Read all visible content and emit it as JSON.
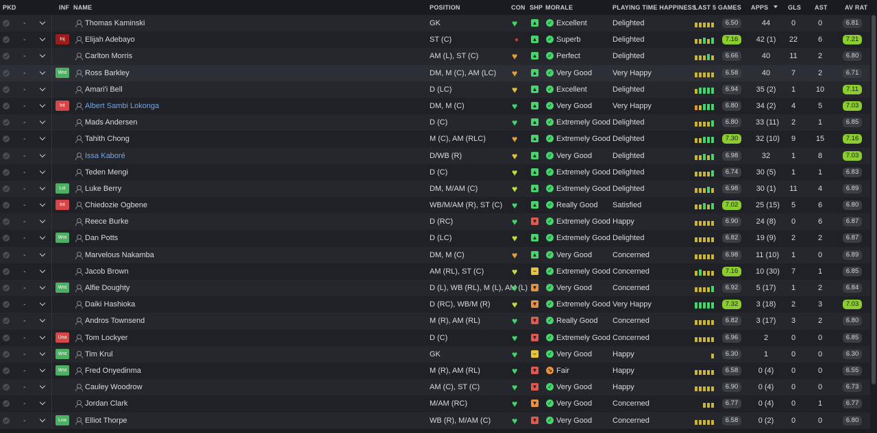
{
  "headers": {
    "pkd": "PKD",
    "inf": "INF",
    "name": "NAME",
    "position": "POSITION",
    "con": "CON",
    "shp": "SHP",
    "morale": "MORALE",
    "pth": "PLAYING TIME HAPPINESS",
    "last5": "LAST 5 GAMES",
    "apps": "APPS",
    "gls": "GLS",
    "ast": "AST",
    "avrat": "AV RAT"
  },
  "colors": {
    "green": "#44d66a",
    "yellow": "#e7c33a",
    "orange": "#e8913d",
    "red": "#e2584e",
    "rating_good": "#8bcd2e",
    "link": "#6fa8e8"
  },
  "players": [
    {
      "name": "Thomas Kaminski",
      "inf": "",
      "pos": "GK",
      "con": "g",
      "shp": "g",
      "mor": "g",
      "morale": "Excellent",
      "pth": "Delighted",
      "l5": "6.50",
      "l5hi": false,
      "bars": [
        "y",
        "y",
        "y",
        "y",
        "y"
      ],
      "apps": "44",
      "gls": "0",
      "ast": "0",
      "av": "6.81",
      "avhi": false,
      "link": false,
      "hl": false
    },
    {
      "name": "Elijah Adebayo",
      "inf": "Inj",
      "infc": "dred",
      "pos": "ST (C)",
      "con": "injdot",
      "shp": "g",
      "mor": "g",
      "morale": "Superb",
      "pth": "Delighted",
      "l5": "7.16",
      "l5hi": true,
      "bars": [
        "y",
        "y",
        "g",
        "y",
        "g"
      ],
      "apps": "42 (1)",
      "gls": "22",
      "ast": "6",
      "av": "7.21",
      "avhi": true,
      "link": false,
      "hl": false
    },
    {
      "name": "Carlton Morris",
      "inf": "",
      "pos": "AM (L), ST (C)",
      "con": "o",
      "shp": "g",
      "mor": "g",
      "morale": "Perfect",
      "pth": "Delighted",
      "l5": "6.66",
      "l5hi": false,
      "bars": [
        "y",
        "y",
        "y",
        "g",
        "y"
      ],
      "apps": "40",
      "gls": "11",
      "ast": "2",
      "av": "6.80",
      "avhi": false,
      "link": false,
      "hl": false
    },
    {
      "name": "Ross Barkley",
      "inf": "Wnt",
      "infc": "green",
      "pos": "DM, M (C), AM (LC)",
      "con": "o",
      "shp": "g",
      "mor": "g",
      "morale": "Very Good",
      "pth": "Very Happy",
      "l5": "6.58",
      "l5hi": false,
      "bars": [
        "y",
        "y",
        "y",
        "y",
        "y"
      ],
      "apps": "40",
      "gls": "7",
      "ast": "2",
      "av": "6.71",
      "avhi": false,
      "link": false,
      "hl": true
    },
    {
      "name": "Amari'i Bell",
      "inf": "",
      "pos": "D (LC)",
      "con": "y",
      "shp": "g",
      "mor": "g",
      "morale": "Excellent",
      "pth": "Delighted",
      "l5": "6.94",
      "l5hi": false,
      "bars": [
        "y",
        "g",
        "g",
        "g",
        "g"
      ],
      "apps": "35 (2)",
      "gls": "1",
      "ast": "10",
      "av": "7.11",
      "avhi": true,
      "link": false,
      "hl": false
    },
    {
      "name": "Albert Sambi Lokonga",
      "inf": "Int",
      "infc": "red",
      "pos": "DM, M (C)",
      "con": "g",
      "shp": "g",
      "mor": "g",
      "morale": "Very Good",
      "pth": "Very Happy",
      "l5": "6.80",
      "l5hi": false,
      "bars": [
        "o",
        "y",
        "g",
        "g",
        "g"
      ],
      "apps": "34 (2)",
      "gls": "4",
      "ast": "5",
      "av": "7.03",
      "avhi": true,
      "link": true,
      "hl": false
    },
    {
      "name": "Mads Andersen",
      "inf": "",
      "pos": "D (C)",
      "con": "g",
      "shp": "g",
      "mor": "g",
      "morale": "Extremely Good",
      "pth": "Delighted",
      "l5": "6.80",
      "l5hi": false,
      "bars": [
        "y",
        "y",
        "y",
        "y",
        "g"
      ],
      "apps": "33 (11)",
      "gls": "2",
      "ast": "1",
      "av": "6.85",
      "avhi": false,
      "link": false,
      "hl": false
    },
    {
      "name": "Tahith Chong",
      "inf": "",
      "pos": "M (C), AM (RLC)",
      "con": "o",
      "shp": "g",
      "mor": "g",
      "morale": "Extremely Good",
      "pth": "Delighted",
      "l5": "7.30",
      "l5hi": true,
      "bars": [
        "y",
        "y",
        "g",
        "g",
        "g"
      ],
      "apps": "32 (10)",
      "gls": "9",
      "ast": "15",
      "av": "7.16",
      "avhi": true,
      "link": false,
      "hl": false
    },
    {
      "name": "Issa Kaboré",
      "inf": "",
      "pos": "D/WB (R)",
      "con": "y",
      "shp": "g",
      "mor": "g",
      "morale": "Very Good",
      "pth": "Delighted",
      "l5": "6.98",
      "l5hi": false,
      "bars": [
        "y",
        "y",
        "g",
        "y",
        "g"
      ],
      "apps": "32",
      "gls": "1",
      "ast": "8",
      "av": "7.03",
      "avhi": true,
      "link": true,
      "hl": false
    },
    {
      "name": "Teden Mengi",
      "inf": "",
      "pos": "D (C)",
      "con": "lime",
      "shp": "g",
      "mor": "g",
      "morale": "Extremely Good",
      "pth": "Delighted",
      "l5": "6.74",
      "l5hi": false,
      "bars": [
        "y",
        "y",
        "y",
        "y",
        "g"
      ],
      "apps": "30 (5)",
      "gls": "1",
      "ast": "1",
      "av": "6.83",
      "avhi": false,
      "link": false,
      "hl": false
    },
    {
      "name": "Luke Berry",
      "inf": "Lst",
      "infc": "green",
      "pos": "DM, M/AM (C)",
      "con": "lime",
      "shp": "g",
      "mor": "g",
      "morale": "Extremely Good",
      "pth": "Delighted",
      "l5": "6.98",
      "l5hi": false,
      "bars": [
        "y",
        "y",
        "y",
        "g",
        "y"
      ],
      "apps": "30 (1)",
      "gls": "11",
      "ast": "4",
      "av": "6.89",
      "avhi": false,
      "link": false,
      "hl": false
    },
    {
      "name": "Chiedozie Ogbene",
      "inf": "Int",
      "infc": "red",
      "pos": "WB/M/AM (R), ST (C)",
      "con": "g",
      "shp": "g",
      "mor": "g",
      "morale": "Really Good",
      "pth": "Satisfied",
      "l5": "7.02",
      "l5hi": true,
      "bars": [
        "y",
        "y",
        "g",
        "y",
        "g"
      ],
      "apps": "25 (15)",
      "gls": "5",
      "ast": "6",
      "av": "6.80",
      "avhi": false,
      "link": false,
      "hl": false
    },
    {
      "name": "Reece Burke",
      "inf": "",
      "pos": "D (RC)",
      "con": "g",
      "shp": "r",
      "mor": "g",
      "morale": "Extremely Good",
      "pth": "Happy",
      "l5": "6.90",
      "l5hi": false,
      "bars": [
        "y",
        "y",
        "y",
        "y",
        "y"
      ],
      "apps": "24 (8)",
      "gls": "0",
      "ast": "6",
      "av": "6.87",
      "avhi": false,
      "link": false,
      "hl": false
    },
    {
      "name": "Dan Potts",
      "inf": "Wnt",
      "infc": "green",
      "pos": "D (LC)",
      "con": "lime",
      "shp": "g",
      "mor": "g",
      "morale": "Extremely Good",
      "pth": "Delighted",
      "l5": "6.82",
      "l5hi": false,
      "bars": [
        "y",
        "y",
        "y",
        "y",
        "y"
      ],
      "apps": "19 (9)",
      "gls": "2",
      "ast": "2",
      "av": "6.87",
      "avhi": false,
      "link": false,
      "hl": false
    },
    {
      "name": "Marvelous Nakamba",
      "inf": "",
      "pos": "DM, M (C)",
      "con": "o",
      "shp": "g",
      "mor": "g",
      "morale": "Very Good",
      "pth": "Concerned",
      "l5": "6.98",
      "l5hi": false,
      "bars": [
        "y",
        "y",
        "y",
        "y",
        "y"
      ],
      "apps": "11 (10)",
      "gls": "1",
      "ast": "0",
      "av": "6.89",
      "avhi": false,
      "link": false,
      "hl": false
    },
    {
      "name": "Jacob Brown",
      "inf": "",
      "pos": "AM (RL), ST (C)",
      "con": "lime",
      "shp": "y",
      "mor": "g",
      "morale": "Extremely Good",
      "pth": "Concerned",
      "l5": "7.16",
      "l5hi": true,
      "bars": [
        "y",
        "g",
        "y",
        "y",
        "y"
      ],
      "apps": "10 (30)",
      "gls": "7",
      "ast": "1",
      "av": "6.85",
      "avhi": false,
      "link": false,
      "hl": false
    },
    {
      "name": "Alfie Doughty",
      "inf": "Wnt",
      "infc": "green",
      "pos": "D (L), WB (RL), M (L), AM (L)",
      "con": "g",
      "shp": "o",
      "mor": "g",
      "morale": "Very Good",
      "pth": "Concerned",
      "l5": "6.92",
      "l5hi": false,
      "bars": [
        "y",
        "y",
        "y",
        "y",
        "g"
      ],
      "apps": "5 (17)",
      "gls": "1",
      "ast": "2",
      "av": "6.84",
      "avhi": false,
      "link": false,
      "hl": false
    },
    {
      "name": "Daiki Hashioka",
      "inf": "",
      "pos": "D (RC), WB/M (R)",
      "con": "lime",
      "shp": "o",
      "mor": "g",
      "morale": "Extremely Good",
      "pth": "Very Happy",
      "l5": "7.32",
      "l5hi": true,
      "bars": [
        "g",
        "g",
        "g",
        "g",
        "g"
      ],
      "apps": "3 (18)",
      "gls": "2",
      "ast": "3",
      "av": "7.03",
      "avhi": true,
      "link": false,
      "hl": false
    },
    {
      "name": "Andros Townsend",
      "inf": "",
      "pos": "M (R), AM (RL)",
      "con": "g",
      "shp": "r",
      "mor": "g",
      "morale": "Really Good",
      "pth": "Concerned",
      "l5": "6.82",
      "l5hi": false,
      "bars": [
        "y",
        "y",
        "y",
        "y",
        "y"
      ],
      "apps": "3 (17)",
      "gls": "3",
      "ast": "2",
      "av": "6.80",
      "avhi": false,
      "link": false,
      "hl": false
    },
    {
      "name": "Tom Lockyer",
      "inf": "Una",
      "infc": "red",
      "pos": "D (C)",
      "con": "g",
      "shp": "r",
      "mor": "g",
      "morale": "Extremely Good",
      "pth": "Concerned",
      "l5": "6.96",
      "l5hi": false,
      "bars": [
        "y",
        "y",
        "y",
        "y",
        "y"
      ],
      "apps": "2",
      "gls": "0",
      "ast": "0",
      "av": "6.85",
      "avhi": false,
      "link": false,
      "hl": false
    },
    {
      "name": "Tim Krul",
      "inf": "Wnt",
      "infc": "green",
      "pos": "GK",
      "con": "g",
      "shp": "y",
      "mor": "g",
      "morale": "Very Good",
      "pth": "Happy",
      "l5": "6.30",
      "l5hi": false,
      "bars": [
        "",
        "",
        "",
        "",
        "y"
      ],
      "apps": "1",
      "gls": "0",
      "ast": "0",
      "av": "6.30",
      "avhi": false,
      "link": false,
      "hl": false
    },
    {
      "name": "Fred Onyedinma",
      "inf": "Wnt",
      "infc": "green",
      "pos": "M (R), AM (RL)",
      "con": "g",
      "shp": "r",
      "mor": "o",
      "morale": "Fair",
      "pth": "Happy",
      "l5": "6.58",
      "l5hi": false,
      "bars": [
        "y",
        "y",
        "y",
        "y",
        "y"
      ],
      "apps": "0 (4)",
      "gls": "0",
      "ast": "0",
      "av": "6.55",
      "avhi": false,
      "link": false,
      "hl": false
    },
    {
      "name": "Cauley Woodrow",
      "inf": "",
      "pos": "AM (C), ST (C)",
      "con": "g",
      "shp": "r",
      "mor": "g",
      "morale": "Very Good",
      "pth": "Happy",
      "l5": "6.90",
      "l5hi": false,
      "bars": [
        "y",
        "y",
        "y",
        "y",
        "y"
      ],
      "apps": "0 (4)",
      "gls": "0",
      "ast": "0",
      "av": "6.73",
      "avhi": false,
      "link": false,
      "hl": false
    },
    {
      "name": "Jordan Clark",
      "inf": "",
      "pos": "M/AM (RC)",
      "con": "g",
      "shp": "o",
      "mor": "g",
      "morale": "Very Good",
      "pth": "Concerned",
      "l5": "6.77",
      "l5hi": false,
      "bars": [
        "",
        "",
        "y",
        "y",
        "y"
      ],
      "apps": "0 (4)",
      "gls": "0",
      "ast": "1",
      "av": "6.77",
      "avhi": false,
      "link": false,
      "hl": false
    },
    {
      "name": "Elliot Thorpe",
      "inf": "Loa",
      "infc": "green",
      "pos": "WB (R), M/AM (C)",
      "con": "g",
      "shp": "r",
      "mor": "g",
      "morale": "Very Good",
      "pth": "Concerned",
      "l5": "6.58",
      "l5hi": false,
      "bars": [
        "y",
        "y",
        "y",
        "y",
        "y"
      ],
      "apps": "0 (2)",
      "gls": "0",
      "ast": "0",
      "av": "6.80",
      "avhi": false,
      "link": false,
      "hl": false
    }
  ]
}
